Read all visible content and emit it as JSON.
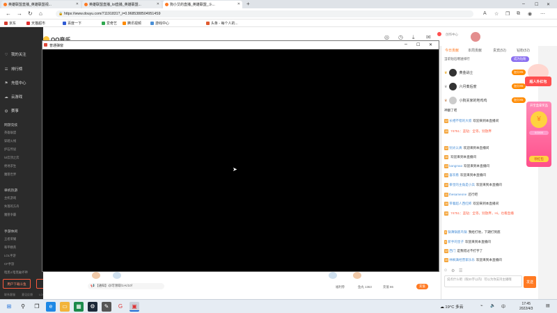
{
  "browser": {
    "tabs": [
      {
        "title": "英雄联盟直播_英雄联盟视..."
      },
      {
        "title": "英雄联盟直播_lol直播_英雄联盟..."
      },
      {
        "title": "狗小艾的直播_英雄联盟_斗..."
      }
    ],
    "url": "https://www.douyu.com/71191831?_i=0.96853885049514S9",
    "bookmarks": [
      "京东",
      "天猫超市",
      "百度一下",
      "爱奇艺",
      "腾讯视频",
      "游戏中心",
      "头条 - 每个人的..."
    ],
    "bookmark_colors": [
      "#d43b2f",
      "#e02f2f",
      "#2f5bd4",
      "#2fa84f",
      "#ff8a00",
      "#4a8fd6",
      "#e05a2f"
    ]
  },
  "leftnav": {
    "items": [
      {
        "icon": "heart-icon",
        "label": "我的关注"
      },
      {
        "icon": "list-icon",
        "label": "排行榜"
      },
      {
        "icon": "flag-icon",
        "label": "充值中心"
      },
      {
        "icon": "cloud-icon",
        "label": "云游戏"
      },
      {
        "icon": "chat-icon",
        "label": "赛事"
      }
    ],
    "sections": [
      {
        "title": "网游竞技",
        "subs": [
          "英雄联盟",
          "穿越火线",
          "炉石传说",
          "lol云顶之弈",
          "绝地求生",
          "魔兽世界"
        ]
      },
      {
        "title": "单机热游",
        "subs": [
          "主机游戏",
          "失落的方舟",
          "魔兽争霸"
        ]
      },
      {
        "title": "手游休闲",
        "subs": [
          "王者荣耀",
          "和平精英",
          "LOL手游",
          "CF手游",
          "暗黑4 暗黑破坏神"
        ]
      }
    ],
    "btn_left": "用户下载斗鱼",
    "btn_right": "回到斗鱼",
    "footer": [
      "联系客服",
      "意见反馈",
      "LOGO下载"
    ]
  },
  "header": {
    "logo": "QQ音乐",
    "user_tiles": [
      "消息",
      "历史",
      "客户端",
      "任务",
      "钻石",
      "创作中心"
    ]
  },
  "popup": {
    "title": "普通弹窗"
  },
  "chat": {
    "tabs": [
      "今日贡献",
      "本周贡献",
      "贵宾(52)",
      "钻粉(52)"
    ],
    "banner": "当前钻石赠送排行",
    "banner_btn": "成为钻粉",
    "ranks": [
      {
        "name": "黄金战士",
        "badge": "加分X5"
      },
      {
        "name": "六月奏后度",
        "badge": "加分X5"
      },
      {
        "name": "小狗关家的地鸡鸡",
        "badge": "加分X5"
      }
    ],
    "messages": [
      {
        "text": "神翻了吧"
      },
      {
        "lv": "12",
        "name": "长相不错的大叔",
        "text": "欢迎来到本直播间"
      },
      {
        "lv": "15",
        "name": "",
        "text": "74751：蓝钻：全等，别放弃"
      },
      {
        "lv": "12",
        "name": "别太认真",
        "text": "欢迎来到本直播间"
      },
      {
        "lv": "16",
        "name": "",
        "text": "欢迎来到本直播间"
      },
      {
        "lv": "13",
        "name": "kangmao",
        "text": "欢迎来到本直播间"
      },
      {
        "lv": "13",
        "name": "喜欢看",
        "text": "欢迎来到本直播间"
      },
      {
        "lv": "10",
        "name": "拳皇的主角是小兵",
        "text": "欢迎来到本直播间"
      },
      {
        "lv": "11",
        "name": "thesameone",
        "text": "还行吧"
      },
      {
        "lv": "16",
        "name": "带着超人西红柿",
        "text": "欢迎来到本直播间"
      },
      {
        "lv": "16",
        "name": "",
        "text": "74751：蓝钻：全等，别放弃，Hi，也看直播"
      },
      {
        "lv": "5",
        "name": "锅薄锅底鸟锅",
        "text": "我给打他，下期打到底"
      },
      {
        "lv": "9",
        "name": "新手的皇子",
        "text": "欢迎来到本直播间"
      },
      {
        "lv": "12",
        "name": "西门",
        "text": "是我错过不打字了"
      },
      {
        "lv": "10",
        "name": "林枫满经营家乐乐",
        "text": "欢迎来到本直播间"
      }
    ],
    "input_placeholder": "说点什么吧（限20字以内）可以为你支持主播哦",
    "send": "发送"
  },
  "promo": {
    "label1": "超人外红包",
    "label2": "开宝盒拿奖品",
    "progress": "0/1500",
    "btn": "领红包"
  },
  "giftbar": {
    "notice": "【通知】@可领取/1-K/10！",
    "counts": [
      "福利券",
      "鱼丸 1363",
      "充值 86",
      "充值"
    ]
  },
  "taskbar": {
    "weather": "19°C 多云",
    "time": "17:45",
    "date": "2022/4/3"
  }
}
